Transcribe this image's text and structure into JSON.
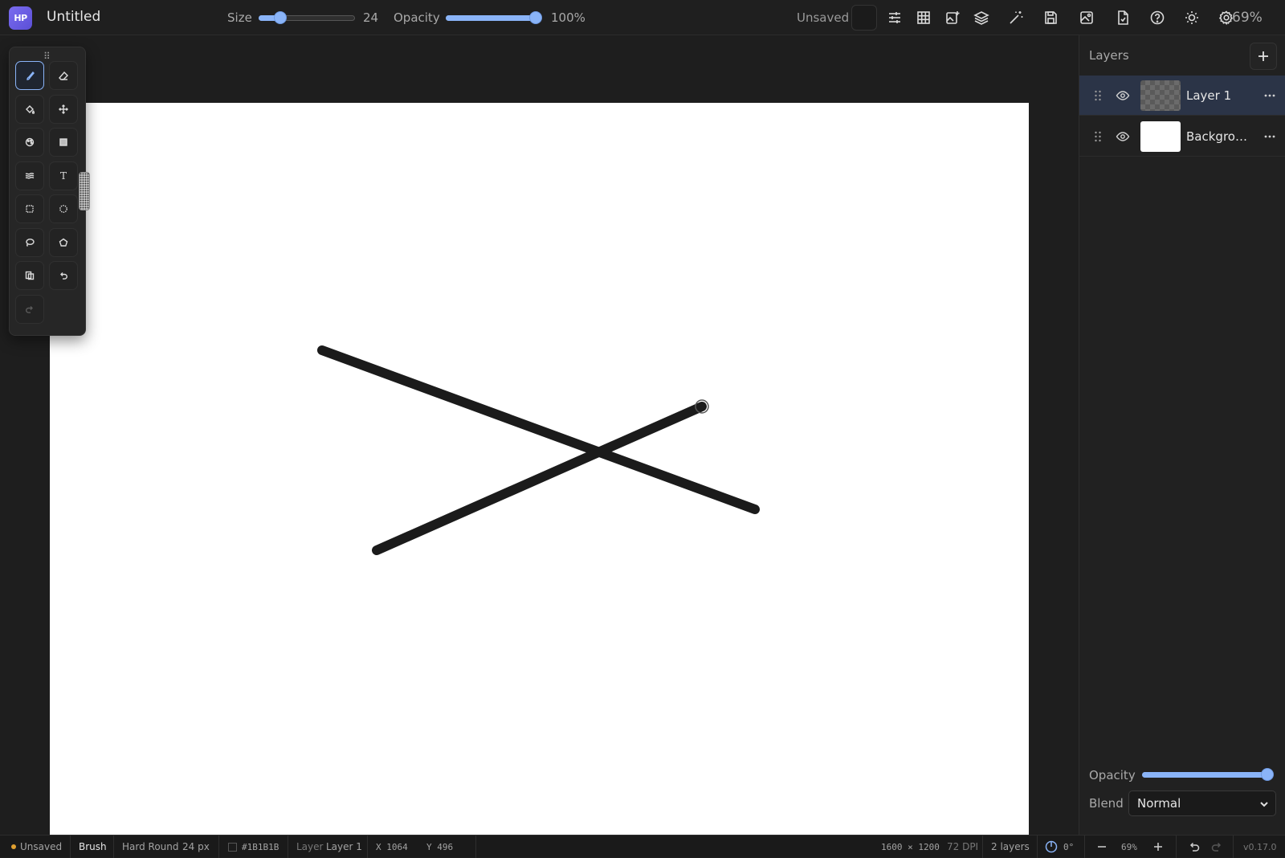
{
  "app": {
    "logo_text": "HP",
    "doc_title": "Untitled"
  },
  "toolbar": {
    "size_label": "Size",
    "size_value": "24",
    "size_fraction": 0.18,
    "opacity_label": "Opacity",
    "opacity_value": "100%",
    "opacity_fraction": 1.0,
    "status": "Unsaved",
    "color": "#1B1B1B",
    "zoom": "69%",
    "buttons": [
      "adjustments-icon",
      "grid-icon",
      "image-add-icon",
      "layers-icon",
      "magic-wand-icon",
      "save-icon",
      "export-image-icon",
      "export-file-icon",
      "help-icon",
      "theme-sun-icon",
      "settings-gear-icon"
    ]
  },
  "tools": [
    {
      "name": "brush-icon",
      "active": true
    },
    {
      "name": "eraser-icon"
    },
    {
      "name": "fill-bucket-icon"
    },
    {
      "name": "move-icon"
    },
    {
      "name": "color-picker-icon"
    },
    {
      "name": "gradient-icon"
    },
    {
      "name": "smudge-icon"
    },
    {
      "name": "text-icon",
      "glyph": "T"
    },
    {
      "name": "rect-select-icon"
    },
    {
      "name": "ellipse-select-icon"
    },
    {
      "name": "lasso-icon"
    },
    {
      "name": "polygon-select-icon"
    },
    {
      "name": "copy-icon"
    },
    {
      "name": "undo-icon"
    },
    {
      "name": "redo-icon",
      "disabled": true
    }
  ],
  "layers_panel": {
    "title": "Layers",
    "layers": [
      {
        "name": "Layer 1",
        "selected": true,
        "thumb": "transparent"
      },
      {
        "name": "Background",
        "selected": false,
        "thumb": "white"
      }
    ],
    "opacity_label": "Opacity",
    "opacity_fraction": 1.0,
    "blend_label": "Blend",
    "blend_value": "Normal"
  },
  "statusbar": {
    "state": "Unsaved",
    "tool": "Brush",
    "brush": "Hard Round",
    "brush_size": "24 px",
    "color": "#1B1B1B",
    "layer_label": "Layer",
    "layer_value": "Layer 1",
    "x": "X 1064",
    "y": "Y 496",
    "dimensions": "1600 × 1200",
    "dpi": "72 DPI",
    "layer_count": "2 layers",
    "rotation": "0°",
    "zoom": "69%",
    "version": "v0.17.0"
  },
  "colors": {
    "accent": "#8ab4f8",
    "unsaved_dot": "#e0a030",
    "ink": "#1B1B1B"
  }
}
